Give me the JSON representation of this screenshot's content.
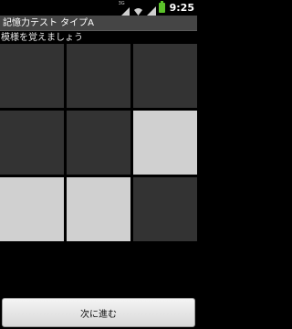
{
  "status_bar": {
    "time": "9:25",
    "signal_label": "3G",
    "icons": [
      "signal-icon",
      "wifi-icon",
      "cell-signal-icon",
      "battery-icon"
    ],
    "battery_color": "#5bc22a"
  },
  "title_bar": {
    "title": "記憶力テスト タイプA"
  },
  "instruction": "模様を覚えましょう",
  "grid": {
    "rows": 3,
    "cols": 3,
    "cells": [
      [
        false,
        false,
        false
      ],
      [
        false,
        false,
        true
      ],
      [
        true,
        true,
        false
      ]
    ],
    "on_color": "#d0d0d0",
    "off_color": "#333333"
  },
  "next_button": {
    "label": "次に進む"
  }
}
